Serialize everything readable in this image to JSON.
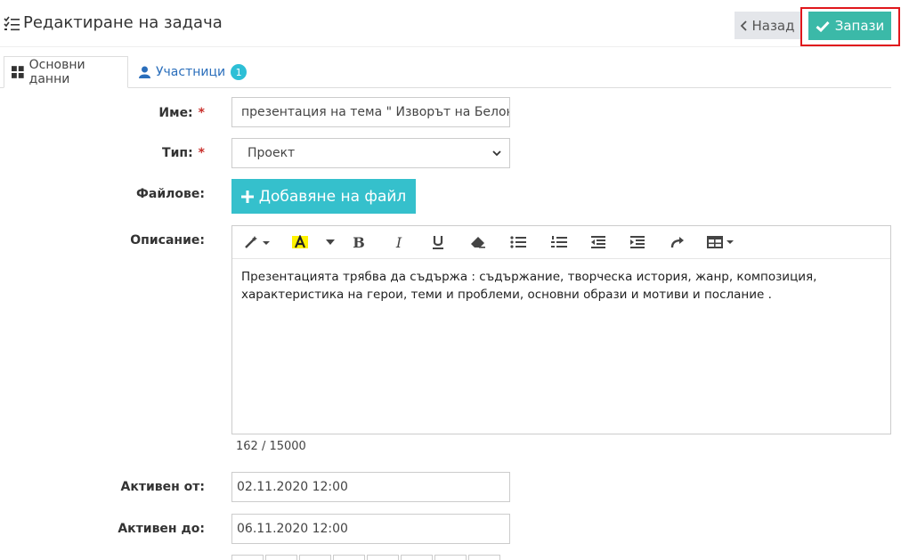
{
  "header": {
    "title": "Редактиране на задача",
    "back_label": "Назад",
    "save_label": "Запази"
  },
  "tabs": [
    {
      "label": "Основни данни",
      "icon": "grid-icon",
      "active": true
    },
    {
      "label": "Участници",
      "icon": "user-icon",
      "badge": "1",
      "active": false
    }
  ],
  "form": {
    "name_label": "Име:",
    "name_value": "презентация на тема \" Изворът на Белонс",
    "type_label": "Тип:",
    "type_value": "Проект",
    "files_label": "Файлове:",
    "add_file_label": "Добавяне на файл",
    "description_label": "Описание:",
    "description_text": "Презентацията трябва да съдържа : съдържание, творческа история, жанр, композиция, характеристика на герои,  теми и проблеми, основни образи и мотиви и послание .",
    "char_counter": "162 / 15000",
    "active_from_label": "Активен от:",
    "active_from_value": "02.11.2020 12:00",
    "active_to_label": "Активен до:",
    "active_to_value": "06.11.2020 12:00",
    "required_mark": "*"
  },
  "toolbar_icons": [
    "magic-wand-icon",
    "highlight-color-icon",
    "bold-icon",
    "italic-icon",
    "underline-icon",
    "eraser-icon",
    "bullet-list-icon",
    "numbered-list-icon",
    "outdent-icon",
    "indent-icon",
    "redo-icon",
    "table-icon"
  ],
  "colors": {
    "save": "#3bb9a8",
    "add_file": "#35c0cc",
    "badge": "#2dbfd6",
    "highlight": "#fff200",
    "link": "#2a6ebb",
    "required": "#c9302c"
  }
}
